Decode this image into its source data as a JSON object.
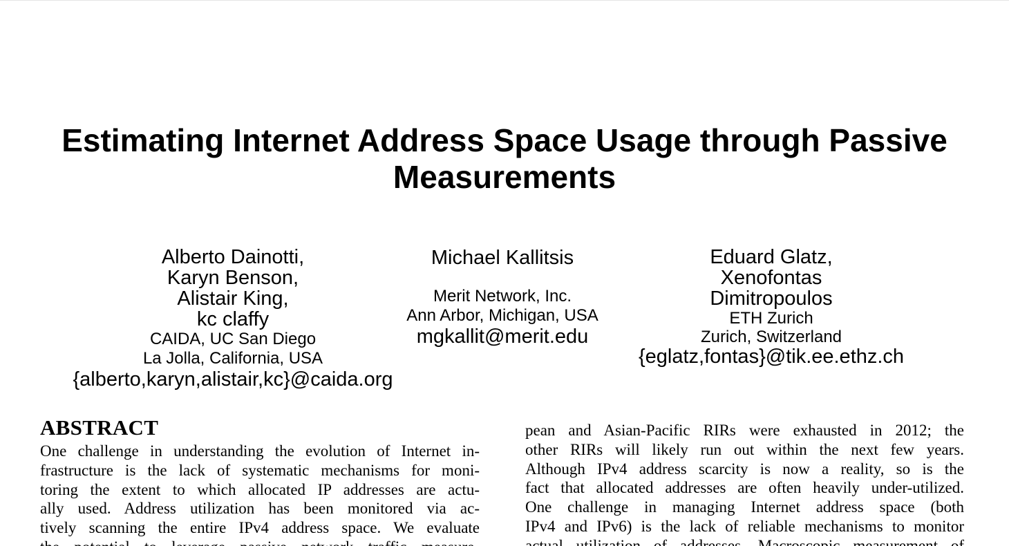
{
  "paper": {
    "title_line1": "Estimating Internet Address Space Usage through Passive",
    "title_line2": "Measurements"
  },
  "authors": [
    {
      "names": [
        "Alberto Dainotti,",
        "Karyn Benson,",
        "Alistair King,",
        "kc claffy"
      ],
      "affiliation": [
        "CAIDA, UC San Diego",
        "La Jolla, California, USA"
      ],
      "email": "{alberto,karyn,alistair,kc}@caida.org"
    },
    {
      "names": [
        "Michael Kallitsis"
      ],
      "affiliation": [
        "Merit Network, Inc.",
        "Ann Arbor, Michigan, USA"
      ],
      "email": "mgkallit@merit.edu"
    },
    {
      "names": [
        "Eduard Glatz,",
        "Xenofontas",
        "Dimitropoulos"
      ],
      "affiliation": [
        "ETH Zurich",
        "Zurich, Switzerland"
      ],
      "email": "{eglatz,fontas}@tik.ee.ethz.ch"
    }
  ],
  "abstract": {
    "heading": "ABSTRACT",
    "lines": [
      "One challenge in understanding the evolution of Internet in-",
      "frastructure is the lack of systematic mechanisms for moni-",
      "toring the extent to which allocated IP addresses are actu-",
      "ally used.  Address utilization has been monitored via ac-",
      "tively scanning the entire IPv4 address space.  We evaluate",
      "the potential to leverage passive network traffic measure-"
    ]
  },
  "right_column": {
    "lines": [
      "pean and Asian-Pacific RIRs were exhausted in 2012; the",
      "other RIRs will likely run out within the next few years.",
      "Although IPv4 address scarcity is now a reality, so is the",
      "fact that allocated addresses are often heavily under-utilized.",
      "One challenge in managing Internet address space (both",
      "IPv4 and IPv6) is the lack of reliable mechanisms to monitor",
      "actual utilization of addresses.  Macroscopic measurement of"
    ]
  }
}
